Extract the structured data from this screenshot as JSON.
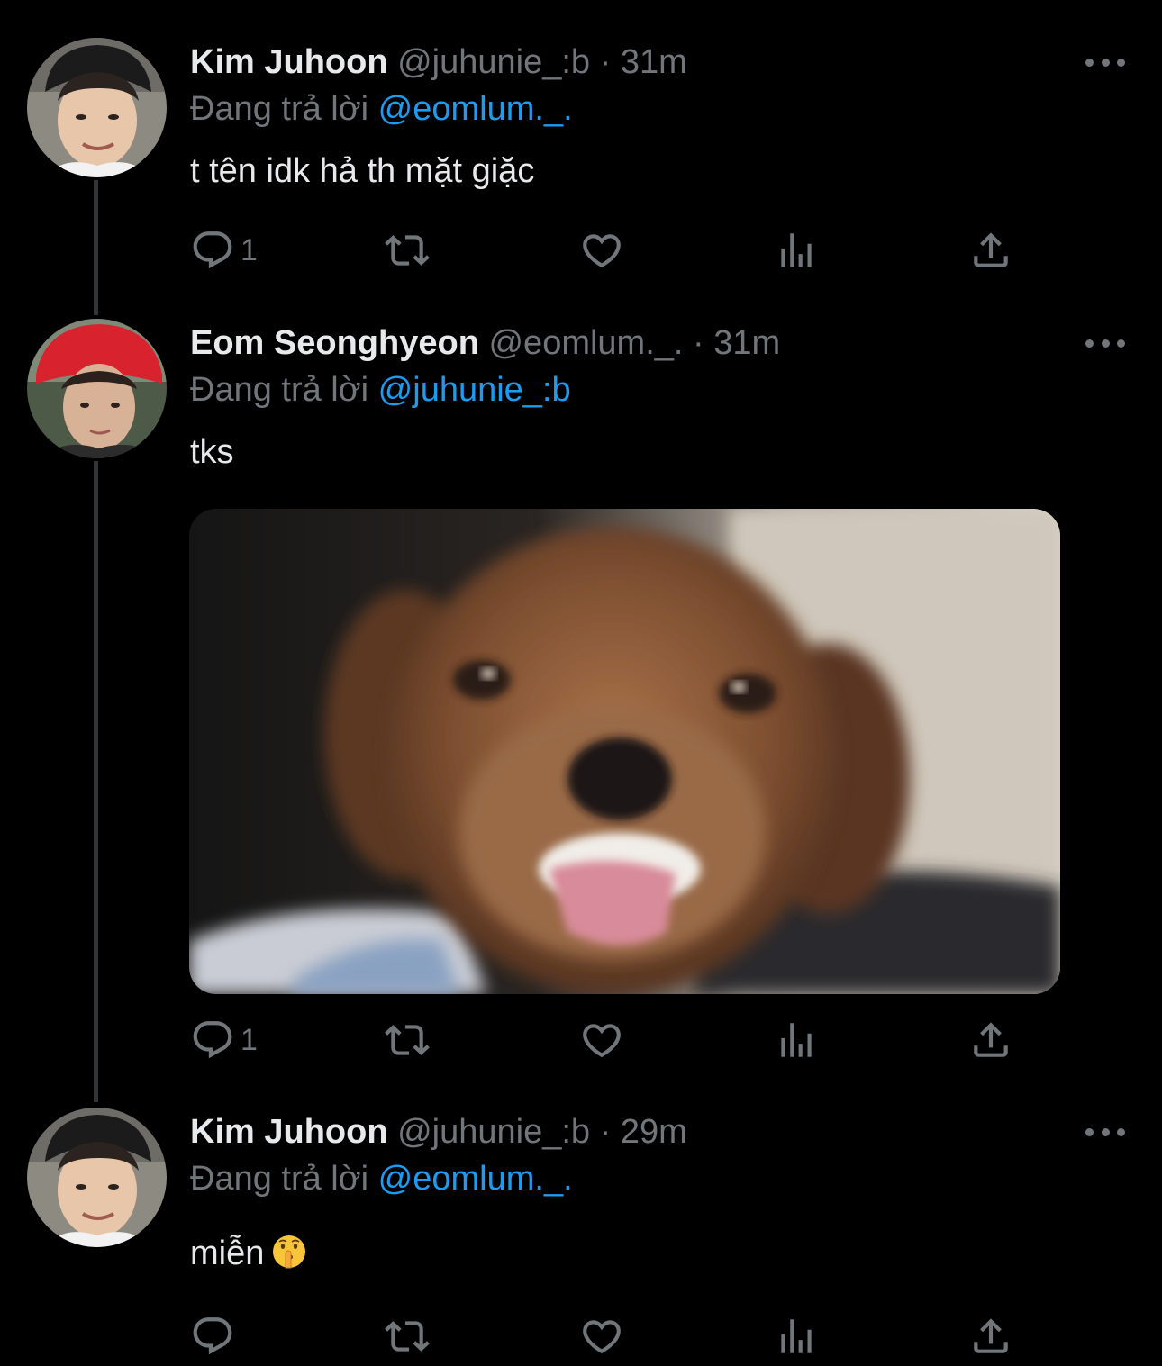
{
  "tweets": [
    {
      "name": "Kim Juhoon",
      "handle": "@juhunie_:b",
      "separator": "·",
      "time": "31m",
      "reply_prefix": "Đang trả lời",
      "reply_to": "@eomlum._.",
      "text": "t tên idk hả th mặt giặc",
      "reply_count": "1"
    },
    {
      "name": "Eom Seonghyeon",
      "handle": "@eomlum._.",
      "separator": "·",
      "time": "31m",
      "reply_prefix": "Đang trả lời",
      "reply_to": "@juhunie_:b",
      "text": "tks",
      "reply_count": "1",
      "media": "photo of a small brown dog with its tongue out"
    },
    {
      "name": "Kim Juhoon",
      "handle": "@juhunie_:b",
      "separator": "·",
      "time": "29m",
      "reply_prefix": "Đang trả lời",
      "reply_to": "@eomlum._.",
      "text": "miễn",
      "emoji": "shushing-face",
      "reply_count": ""
    }
  ],
  "icons": {
    "reply": "reply-icon",
    "retweet": "retweet-icon",
    "like": "heart-icon",
    "views": "views-icon",
    "share": "share-icon",
    "more": "more-icon"
  },
  "colors": {
    "background": "#000000",
    "primary_text": "#e7e9ea",
    "secondary_text": "#71767b",
    "link": "#1d9bf0",
    "thread_line": "#333639"
  }
}
